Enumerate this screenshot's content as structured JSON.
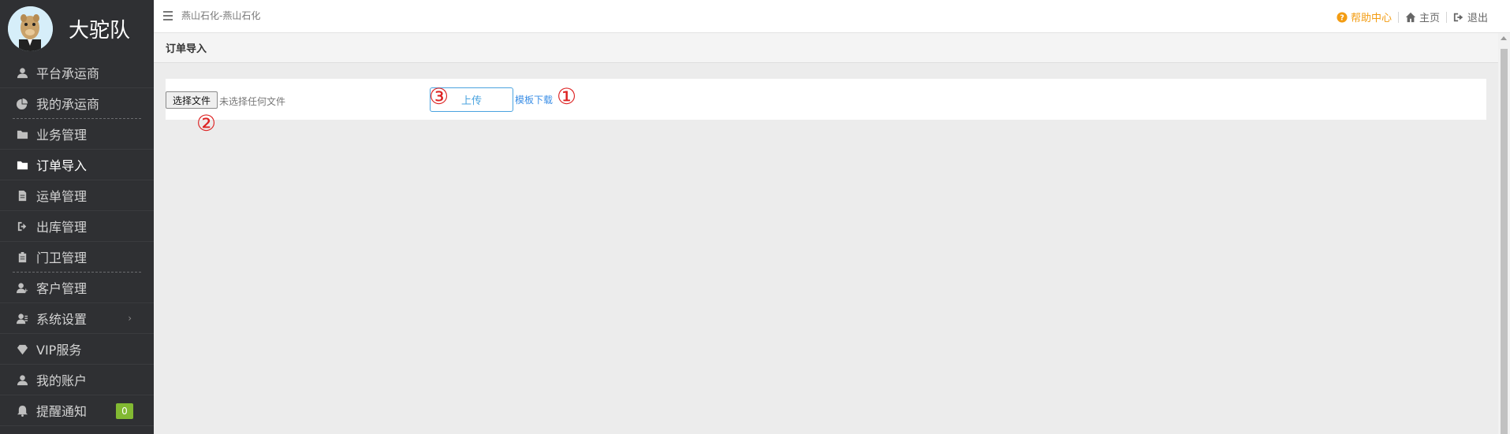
{
  "brand": {
    "name": "大驼队"
  },
  "sidebar": {
    "items": [
      {
        "label": "平台承运商",
        "icon": "user-icon"
      },
      {
        "label": "我的承运商",
        "icon": "pie-chart-icon"
      },
      {
        "label": "业务管理",
        "icon": "folder-icon"
      },
      {
        "label": "订单导入",
        "icon": "folder-icon"
      },
      {
        "label": "运单管理",
        "icon": "file-icon"
      },
      {
        "label": "出库管理",
        "icon": "sign-out-icon"
      },
      {
        "label": "门卫管理",
        "icon": "clipboard-icon"
      },
      {
        "label": "客户管理",
        "icon": "user-plus-icon"
      },
      {
        "label": "系统设置",
        "icon": "user-settings-icon",
        "chevron": "›"
      },
      {
        "label": "VIP服务",
        "icon": "diamond-icon"
      },
      {
        "label": "我的账户",
        "icon": "user-icon"
      },
      {
        "label": "提醒通知",
        "icon": "bell-icon",
        "badge": "0"
      }
    ]
  },
  "topbar": {
    "breadcrumb": "燕山石化-燕山石化",
    "help": "帮助中心",
    "home": "主页",
    "logout": "退出"
  },
  "page": {
    "title": "订单导入",
    "file_button": "选择文件",
    "file_status": "未选择任何文件",
    "upload_button": "上传",
    "template_link": "模板下载"
  },
  "annotations": {
    "one": "①",
    "two": "②",
    "three": "③"
  },
  "colors": {
    "sidebar_bg": "#2f3033",
    "accent": "#4aa3df",
    "help": "#f39c12",
    "badge": "#82b932",
    "annotation": "#dd2222"
  }
}
